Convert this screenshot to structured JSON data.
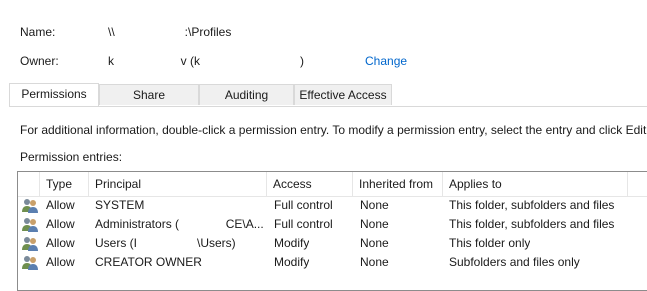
{
  "header": {
    "name_label": "Name:",
    "name_prefix": "\\\\",
    "name_suffix": ":\\Profiles",
    "owner_label": "Owner:",
    "owner_value": "k                    v (k                              )",
    "change_link": "Change"
  },
  "tabs": [
    {
      "label": "Permissions",
      "active": true
    },
    {
      "label": "Share",
      "active": false
    },
    {
      "label": "Auditing",
      "active": false
    },
    {
      "label": "Effective Access",
      "active": false
    }
  ],
  "info_text": "For additional information, double-click a permission entry. To modify a permission entry, select the entry and click Edit",
  "entries_label": "Permission entries:",
  "table": {
    "columns": [
      "Type",
      "Principal",
      "Access",
      "Inherited from",
      "Applies to"
    ],
    "rows": [
      {
        "type": "Allow",
        "principal": "SYSTEM",
        "access": "Full control",
        "inherited": "None",
        "applies": "This folder, subfolders and files"
      },
      {
        "type": "Allow",
        "principal": "Administrators (              CE\\A...",
        "access": "Full control",
        "inherited": "None",
        "applies": "This folder, subfolders and files"
      },
      {
        "type": "Allow",
        "principal": "Users (I                  \\Users)",
        "access": "Modify",
        "inherited": "None",
        "applies": "This folder only"
      },
      {
        "type": "Allow",
        "principal": "CREATOR OWNER",
        "access": "Modify",
        "inherited": "None",
        "applies": "Subfolders and files only"
      }
    ]
  },
  "colors": {
    "link": "#0066cc",
    "border": "#8c8c8c",
    "tab_bg": "#f0f0f0"
  },
  "icons": {
    "row_icon": "user-group-icon"
  }
}
